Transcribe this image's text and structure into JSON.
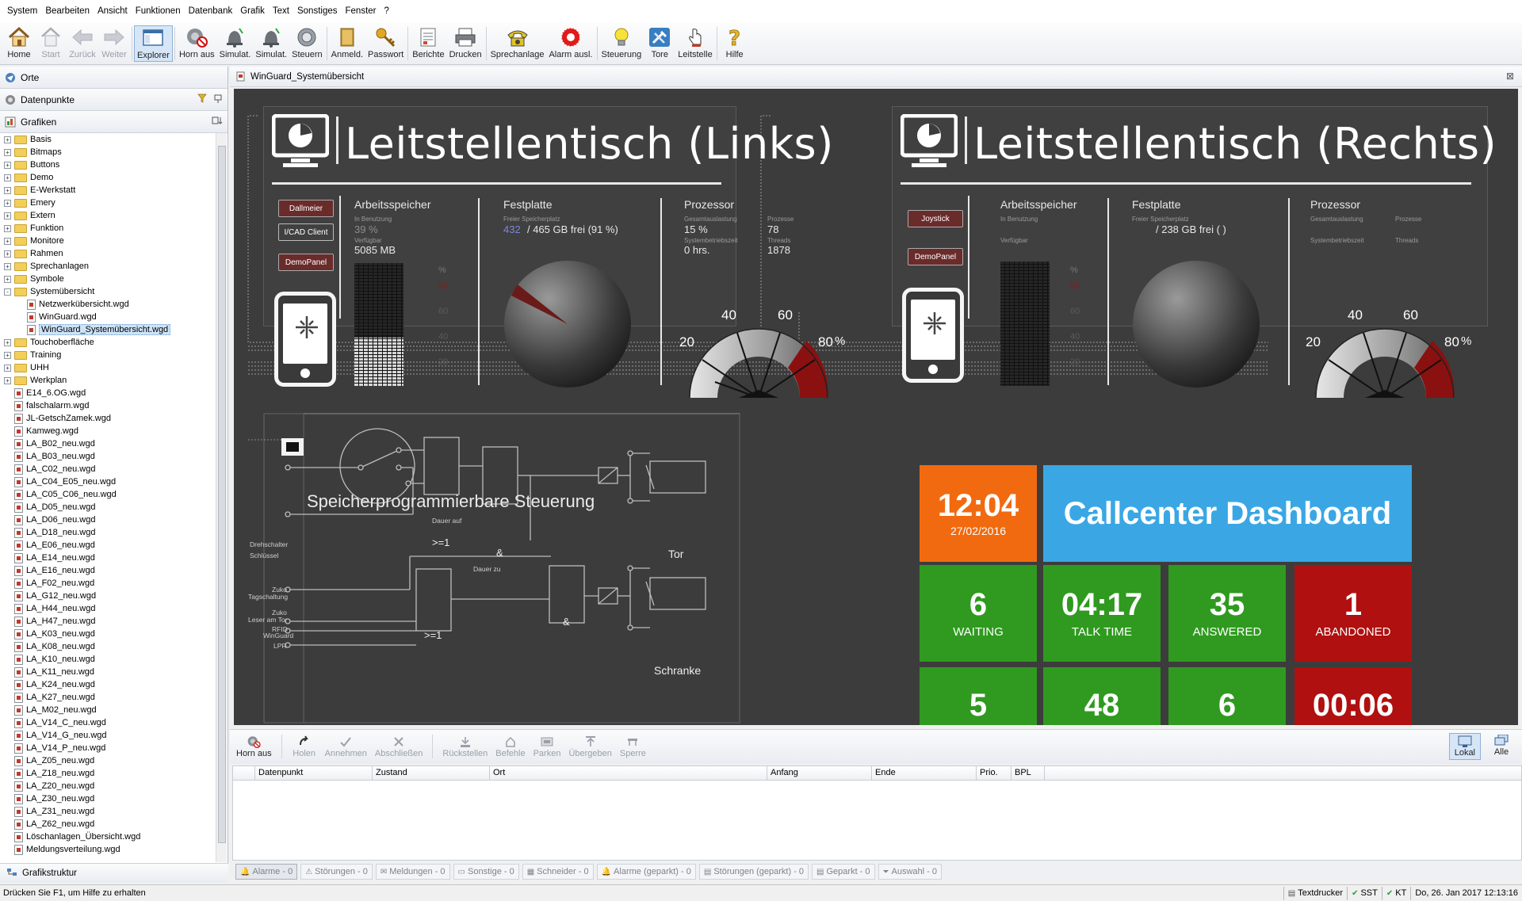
{
  "menu": [
    "System",
    "Bearbeiten",
    "Ansicht",
    "Funktionen",
    "Datenbank",
    "Grafik",
    "Text",
    "Sonstiges",
    "Fenster",
    "?"
  ],
  "toolbar": [
    {
      "label": "Home",
      "icon": "home-icon",
      "state": "enabled"
    },
    {
      "label": "Start",
      "icon": "start-page-icon",
      "state": "disabled"
    },
    {
      "label": "Zurück",
      "icon": "back-arrow-icon",
      "state": "disabled"
    },
    {
      "label": "Weiter",
      "icon": "forward-arrow-icon",
      "state": "disabled"
    },
    {
      "label": "Explorer",
      "icon": "explorer-icon",
      "state": "active"
    },
    {
      "label": "Horn aus",
      "icon": "horn-off-icon",
      "state": "enabled"
    },
    {
      "label": "Simulat.",
      "icon": "bell-simulate-icon",
      "state": "enabled"
    },
    {
      "label": "Simulat.",
      "icon": "bell-simulate-icon",
      "state": "enabled"
    },
    {
      "label": "Steuern",
      "icon": "control-dial-icon",
      "state": "enabled"
    },
    {
      "label": "Anmeld.",
      "icon": "door-icon",
      "state": "enabled"
    },
    {
      "label": "Passwort",
      "icon": "key-icon",
      "state": "enabled"
    },
    {
      "label": "Berichte",
      "icon": "report-icon",
      "state": "enabled"
    },
    {
      "label": "Drucken",
      "icon": "printer-icon",
      "state": "enabled"
    },
    {
      "label": "Sprechanlage",
      "icon": "telephone-icon",
      "state": "enabled"
    },
    {
      "label": "Alarm ausl.",
      "icon": "alarm-trigger-icon",
      "state": "enabled"
    },
    {
      "label": "Steuerung",
      "icon": "lightbulb-icon",
      "state": "enabled"
    },
    {
      "label": "Tore",
      "icon": "tools-icon",
      "state": "enabled"
    },
    {
      "label": "Leitstelle",
      "icon": "hand-pointer-icon",
      "state": "enabled"
    },
    {
      "label": "Hilfe",
      "icon": "help-icon",
      "state": "enabled"
    }
  ],
  "left_panel": {
    "orte": "Orte",
    "datenpunkte": "Datenpunkte",
    "grafiken": "Grafiken",
    "grafikstruktur": "Grafikstruktur"
  },
  "tree": [
    {
      "label": "Basis",
      "type": "folder",
      "level": 0,
      "expander": "+"
    },
    {
      "label": "Bitmaps",
      "type": "folder",
      "level": 0,
      "expander": "+"
    },
    {
      "label": "Buttons",
      "type": "folder",
      "level": 0,
      "expander": "+"
    },
    {
      "label": "Demo",
      "type": "folder",
      "level": 0,
      "expander": "+"
    },
    {
      "label": "E-Werkstatt",
      "type": "folder",
      "level": 0,
      "expander": "+"
    },
    {
      "label": "Emery",
      "type": "folder",
      "level": 0,
      "expander": "+"
    },
    {
      "label": "Extern",
      "type": "folder",
      "level": 0,
      "expander": "+"
    },
    {
      "label": "Funktion",
      "type": "folder",
      "level": 0,
      "expander": "+"
    },
    {
      "label": "Monitore",
      "type": "folder",
      "level": 0,
      "expander": "+"
    },
    {
      "label": "Rahmen",
      "type": "folder",
      "level": 0,
      "expander": "+"
    },
    {
      "label": "Sprechanlagen",
      "type": "folder",
      "level": 0,
      "expander": "+"
    },
    {
      "label": "Symbole",
      "type": "folder",
      "level": 0,
      "expander": "+"
    },
    {
      "label": "Systemübersicht",
      "type": "folder",
      "level": 0,
      "expander": "-"
    },
    {
      "label": "Netzwerkübersicht.wgd",
      "type": "file",
      "level": 1
    },
    {
      "label": "WinGuard.wgd",
      "type": "file",
      "level": 1
    },
    {
      "label": "WinGuard_Systemübersicht.wgd",
      "type": "file",
      "level": 1,
      "selected": true
    },
    {
      "label": "Touchoberfläche",
      "type": "folder",
      "level": 0,
      "expander": "+"
    },
    {
      "label": "Training",
      "type": "folder",
      "level": 0,
      "expander": "+"
    },
    {
      "label": "UHH",
      "type": "folder",
      "level": 0,
      "expander": "+"
    },
    {
      "label": "Werkplan",
      "type": "folder",
      "level": 0,
      "expander": "+"
    },
    {
      "label": "E14_6.OG.wgd",
      "type": "file",
      "level": 0
    },
    {
      "label": "falschalarm.wgd",
      "type": "file",
      "level": 0
    },
    {
      "label": "JL-GetschZamek.wgd",
      "type": "file",
      "level": 0
    },
    {
      "label": "Kamweg.wgd",
      "type": "file",
      "level": 0
    },
    {
      "label": "LA_B02_neu.wgd",
      "type": "file",
      "level": 0
    },
    {
      "label": "LA_B03_neu.wgd",
      "type": "file",
      "level": 0
    },
    {
      "label": "LA_C02_neu.wgd",
      "type": "file",
      "level": 0
    },
    {
      "label": "LA_C04_E05_neu.wgd",
      "type": "file",
      "level": 0
    },
    {
      "label": "LA_C05_C06_neu.wgd",
      "type": "file",
      "level": 0
    },
    {
      "label": "LA_D05_neu.wgd",
      "type": "file",
      "level": 0
    },
    {
      "label": "LA_D06_neu.wgd",
      "type": "file",
      "level": 0
    },
    {
      "label": "LA_D18_neu.wgd",
      "type": "file",
      "level": 0
    },
    {
      "label": "LA_E06_neu.wgd",
      "type": "file",
      "level": 0
    },
    {
      "label": "LA_E14_neu.wgd",
      "type": "file",
      "level": 0
    },
    {
      "label": "LA_E16_neu.wgd",
      "type": "file",
      "level": 0
    },
    {
      "label": "LA_F02_neu.wgd",
      "type": "file",
      "level": 0
    },
    {
      "label": "LA_G12_neu.wgd",
      "type": "file",
      "level": 0
    },
    {
      "label": "LA_H44_neu.wgd",
      "type": "file",
      "level": 0
    },
    {
      "label": "LA_H47_neu.wgd",
      "type": "file",
      "level": 0
    },
    {
      "label": "LA_K03_neu.wgd",
      "type": "file",
      "level": 0
    },
    {
      "label": "LA_K08_neu.wgd",
      "type": "file",
      "level": 0
    },
    {
      "label": "LA_K10_neu.wgd",
      "type": "file",
      "level": 0
    },
    {
      "label": "LA_K11_neu.wgd",
      "type": "file",
      "level": 0
    },
    {
      "label": "LA_K24_neu.wgd",
      "type": "file",
      "level": 0
    },
    {
      "label": "LA_K27_neu.wgd",
      "type": "file",
      "level": 0
    },
    {
      "label": "LA_M02_neu.wgd",
      "type": "file",
      "level": 0
    },
    {
      "label": "LA_V14_C_neu.wgd",
      "type": "file",
      "level": 0
    },
    {
      "label": "LA_V14_G_neu.wgd",
      "type": "file",
      "level": 0
    },
    {
      "label": "LA_V14_P_neu.wgd",
      "type": "file",
      "level": 0
    },
    {
      "label": "LA_Z05_neu.wgd",
      "type": "file",
      "level": 0
    },
    {
      "label": "LA_Z18_neu.wgd",
      "type": "file",
      "level": 0
    },
    {
      "label": "LA_Z20_neu.wgd",
      "type": "file",
      "level": 0
    },
    {
      "label": "LA_Z30_neu.wgd",
      "type": "file",
      "level": 0
    },
    {
      "label": "LA_Z31_neu.wgd",
      "type": "file",
      "level": 0
    },
    {
      "label": "LA_Z62_neu.wgd",
      "type": "file",
      "level": 0
    },
    {
      "label": "Löschanlagen_Übersicht.wgd",
      "type": "file",
      "level": 0
    },
    {
      "label": "Meldungsverteilung.wgd",
      "type": "file",
      "level": 0
    }
  ],
  "document_tab": "WinGuard_Systemübersicht",
  "canvas": {
    "left_desk": {
      "title": "Leitstellentisch (Links)",
      "buttons": [
        "Dallmeier",
        "I/CAD Client",
        "DemoPanel"
      ],
      "ram_head": "Arbeitsspeicher",
      "ram_used_lbl": "In Benutzung",
      "ram_used": "39 %",
      "ram_free_lbl": "Verfügbar",
      "ram_free": "5085 MB",
      "disk_head": "Festplatte",
      "disk_lbl": "Freier Speicherplatz",
      "disk_free": "432",
      "disk_rest": "/ 465 GB frei  (91 %)",
      "cpu_head": "Prozessor",
      "cpu_load_lbl": "Gesamtauslastung",
      "cpu_load": "15 %",
      "cpu_proc_lbl": "Prozesse",
      "cpu_proc": "78",
      "cpu_up_lbl": "Systembetriebszeit",
      "cpu_up": "0 hrs.",
      "cpu_thr_lbl": "Threads",
      "cpu_thr": "1878",
      "pct": [
        "%",
        "80",
        "60",
        "40",
        "20"
      ],
      "gauge": [
        "20",
        "40",
        "60",
        "80",
        "%"
      ]
    },
    "right_desk": {
      "title": "Leitstellentisch (Rechts)",
      "buttons": [
        "Joystick",
        "DemoPanel"
      ],
      "ram_head": "Arbeitsspeicher",
      "ram_used_lbl": "In Benutzung",
      "ram_free_lbl": "Verfügbar",
      "disk_head": "Festplatte",
      "disk_lbl": "Freier Speicherplatz",
      "disk_rest": "/ 238 GB frei  (      )",
      "cpu_head": "Prozessor",
      "cpu_load_lbl": "Gesamtauslastung",
      "cpu_proc_lbl": "Prozesse",
      "cpu_up_lbl": "Systembetriebszeit",
      "cpu_thr_lbl": "Threads",
      "pct": [
        "%",
        "80",
        "60",
        "40",
        "20"
      ],
      "gauge": [
        "20",
        "40",
        "60",
        "80",
        "%"
      ]
    },
    "sps": {
      "title": "Speicherprogrammierbare Steuerung",
      "labels": [
        "Drehschalter",
        "Schlüssel",
        "Zuko",
        "Tagschaltung",
        "Zuko",
        "Leser am Tor",
        "RFID",
        "WinGuard",
        "LPR",
        "Dauer auf",
        "Dauer zu"
      ],
      "gates": [
        ">=1",
        "&",
        "&",
        ">=1"
      ],
      "outputs": [
        "Tor",
        "Schranke"
      ]
    },
    "callcenter": {
      "time": "12:04",
      "date": "27/02/2016",
      "title": "Callcenter Dashboard",
      "tiles": [
        {
          "big": "6",
          "small": "WAITING",
          "color": "#2f9a1f"
        },
        {
          "big": "04:17",
          "small": "TALK TIME",
          "color": "#2f9a1f"
        },
        {
          "big": "35",
          "small": "ANSWERED",
          "color": "#2f9a1f"
        },
        {
          "big": "1",
          "small": "ABANDONED",
          "color": "#b01010"
        },
        {
          "big": "5",
          "small": "",
          "color": "#2f9a1f"
        },
        {
          "big": "48",
          "small": "",
          "color": "#2f9a1f"
        },
        {
          "big": "6",
          "small": "",
          "color": "#2f9a1f"
        },
        {
          "big": "00:06",
          "small": "",
          "color": "#b01010"
        }
      ],
      "time_color": "#f26a0f",
      "title_color": "#3aa7e4"
    }
  },
  "alarm_toolbar": [
    {
      "label": "Horn aus",
      "enabled": true,
      "icon": "horn-off-icon"
    },
    {
      "label": "Holen",
      "enabled": false,
      "icon": "fetch-icon"
    },
    {
      "label": "Annehmen",
      "enabled": false,
      "icon": "accept-check-icon"
    },
    {
      "label": "Abschließen",
      "enabled": false,
      "icon": "close-x-icon"
    },
    {
      "label": "Rückstellen",
      "enabled": false,
      "icon": "reset-icon"
    },
    {
      "label": "Befehle",
      "enabled": false,
      "icon": "command-icon"
    },
    {
      "label": "Parken",
      "enabled": false,
      "icon": "park-icon"
    },
    {
      "label": "Übergeben",
      "enabled": false,
      "icon": "handover-icon"
    },
    {
      "label": "Sperre",
      "enabled": false,
      "icon": "lock-icon"
    }
  ],
  "alarm_right": [
    "Lokal",
    "Alle"
  ],
  "grid_columns": [
    "",
    "Datenpunkt",
    "Zustand",
    "Ort",
    "Anfang",
    "Ende",
    "Prio.",
    "BPL"
  ],
  "bottom_tabs": [
    "Alarme - 0",
    "Störungen - 0",
    "Meldungen - 0",
    "Sonstige - 0",
    "Schneider - 0",
    "Alarme (geparkt) - 0",
    "Störungen (geparkt) - 0",
    "Geparkt - 0",
    "Auswahl - 0"
  ],
  "status": {
    "hint": "Drücken Sie F1, um Hilfe zu erhalten",
    "cells": [
      "Textdrucker",
      "SST",
      "KT",
      "Do, 26. Jan 2017  12:13:16"
    ]
  }
}
